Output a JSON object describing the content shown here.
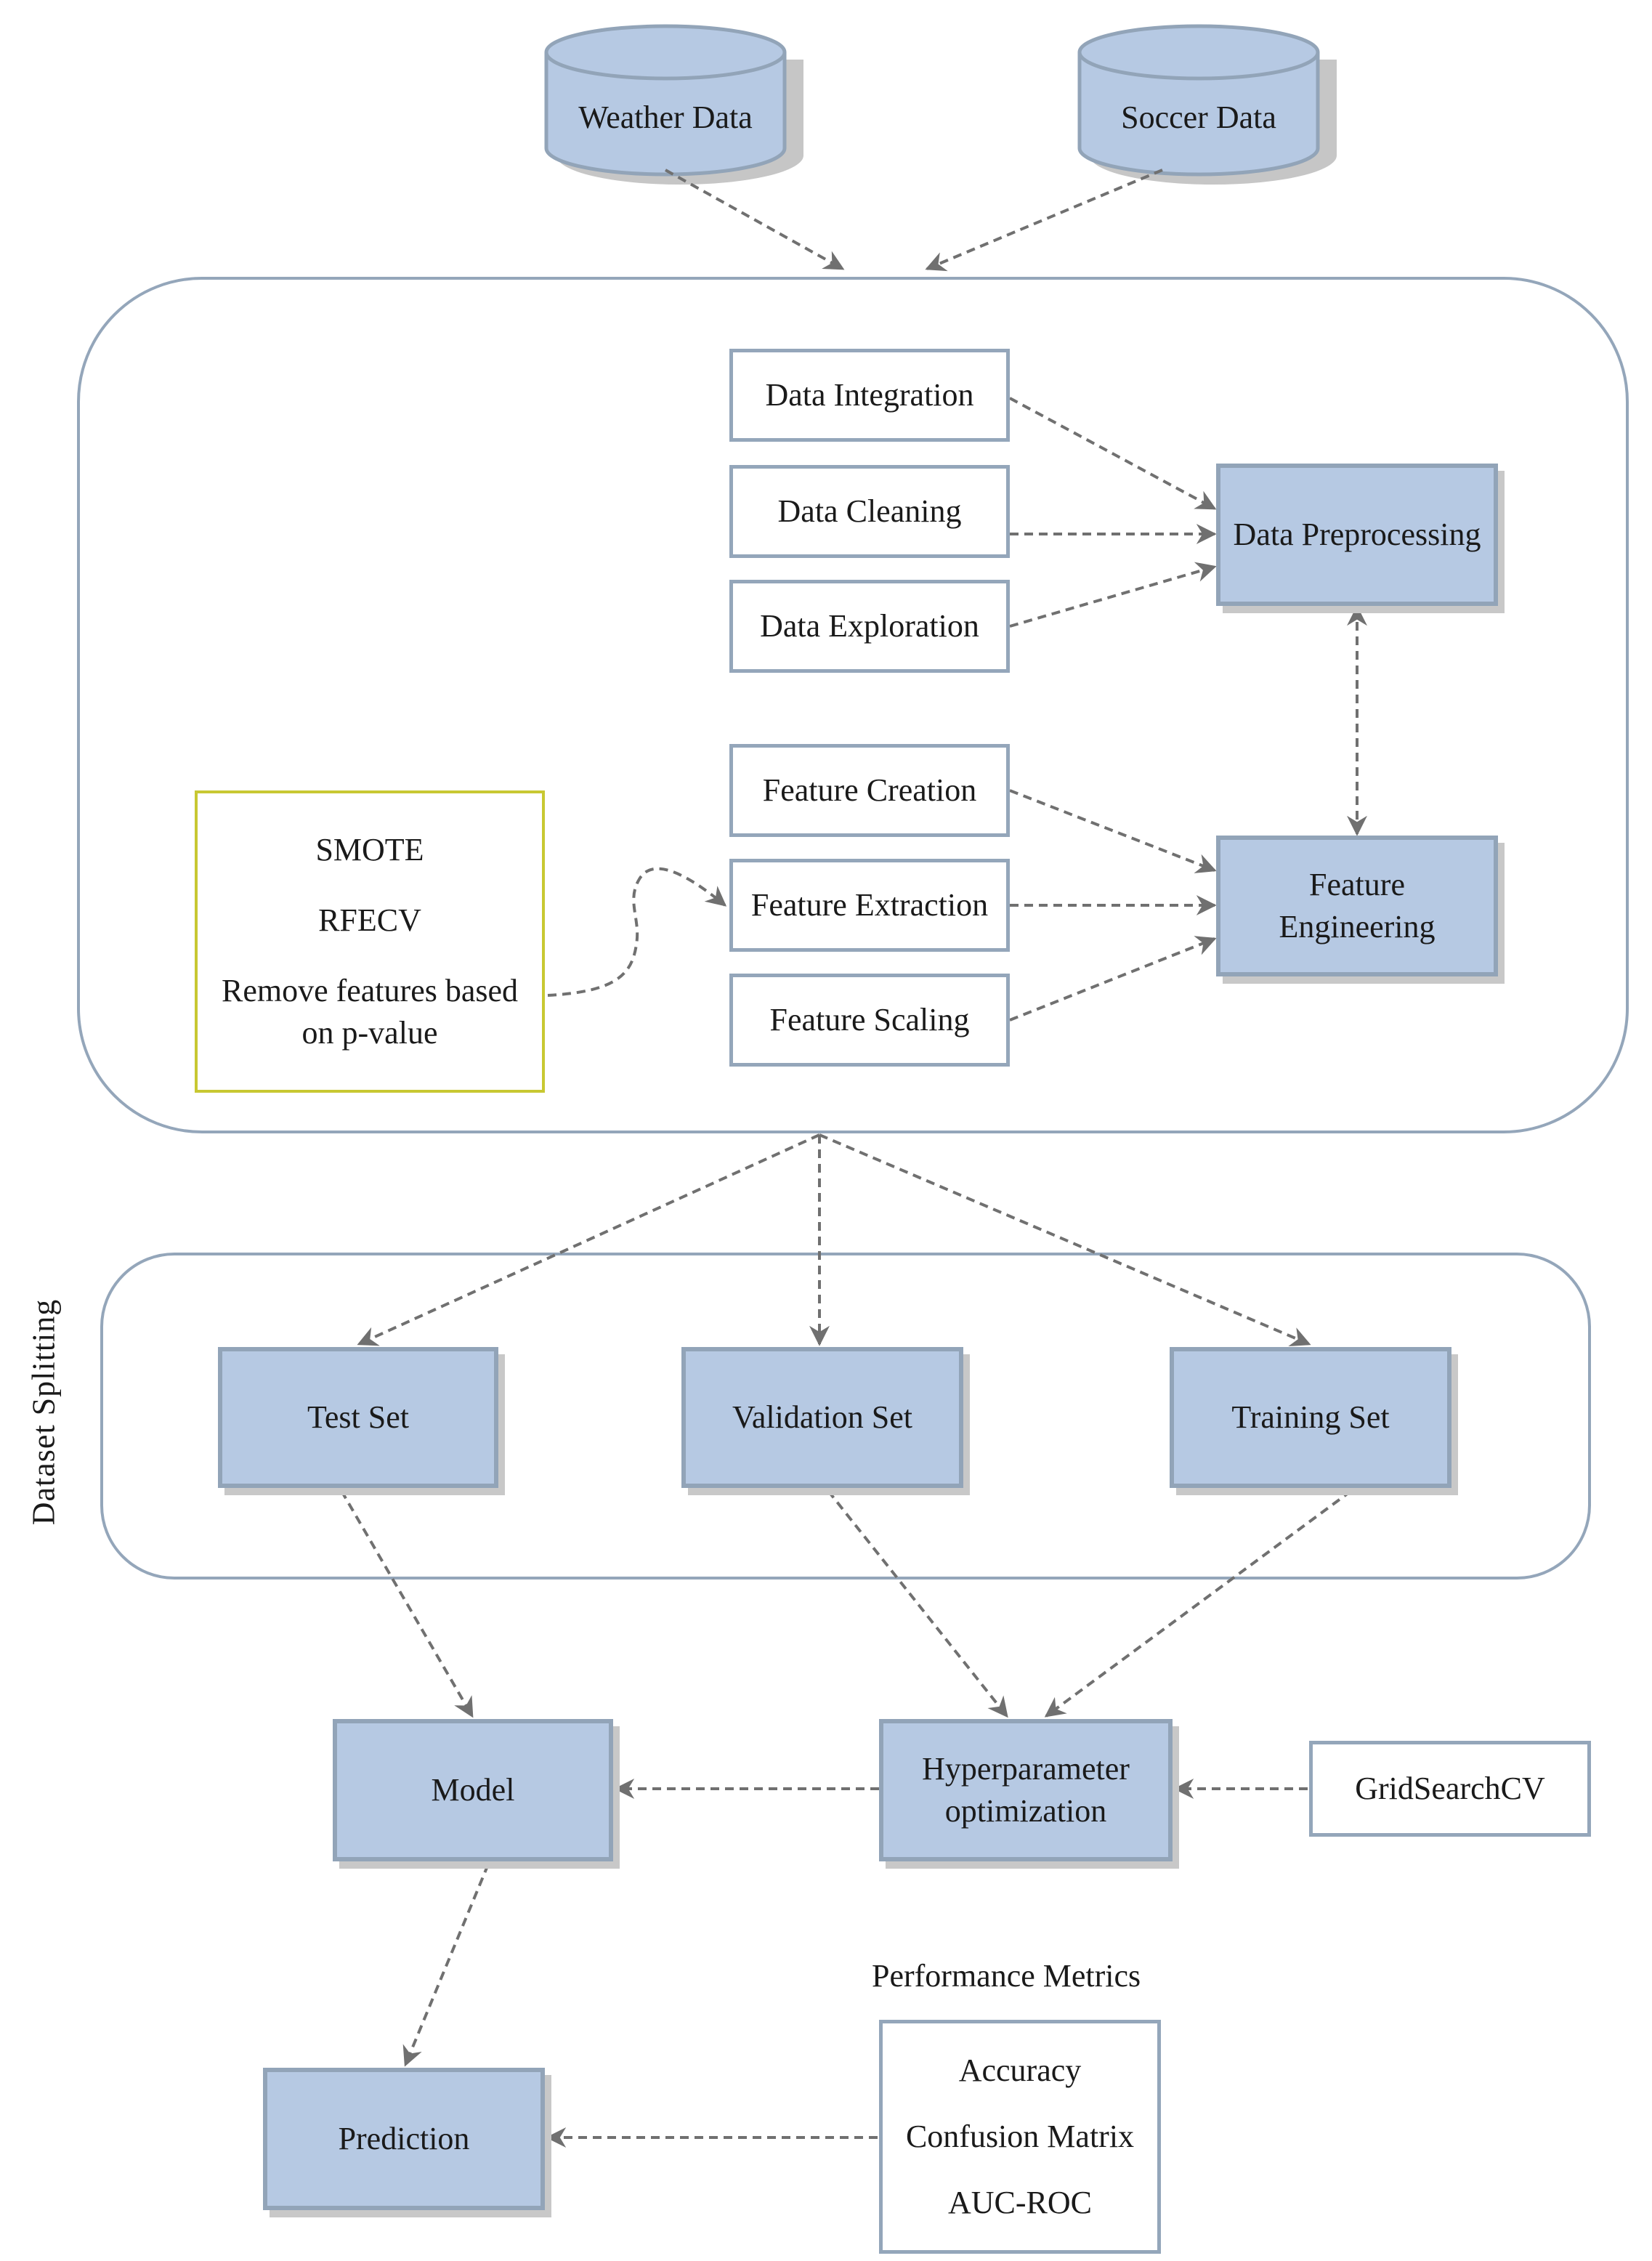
{
  "sources": {
    "weather": "Weather Data",
    "soccer": "Soccer Data"
  },
  "preprocessing": {
    "steps": [
      "Data Integration",
      "Data Cleaning",
      "Data Exploration"
    ],
    "target": "Data Preprocessing"
  },
  "feature_engineering": {
    "steps": [
      "Feature Creation",
      "Feature Extraction",
      "Feature Scaling"
    ],
    "target": "Feature Engineering",
    "techniques": [
      "SMOTE",
      "RFECV",
      "Remove features based on p-value"
    ]
  },
  "dataset_splitting": {
    "label": "Dataset Splitting",
    "sets": [
      "Test Set",
      "Validation Set",
      "Training Set"
    ]
  },
  "modeling": {
    "model": "Model",
    "hyperparameter": "Hyperparameter optimization",
    "search": "GridSearchCV",
    "prediction": "Prediction"
  },
  "metrics": {
    "title": "Performance Metrics",
    "items": [
      "Accuracy",
      "Confusion Matrix",
      "AUC-ROC"
    ]
  },
  "colors": {
    "node_fill": "#b6c9e3",
    "node_border": "#92a4b8",
    "container_border": "#94a6ba",
    "note_border": "#c8c832",
    "arrow": "#707070",
    "shadow": "#c8c8c8"
  }
}
